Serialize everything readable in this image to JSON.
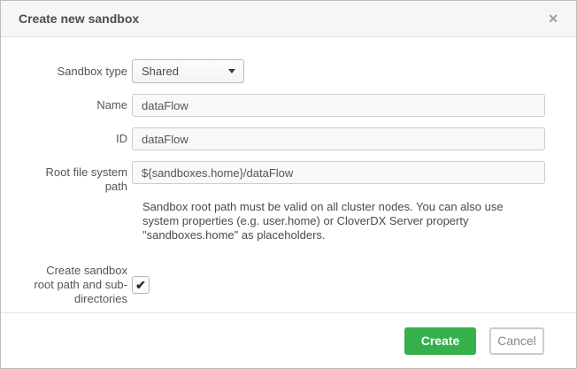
{
  "dialog": {
    "title": "Create new sandbox"
  },
  "icons": {
    "close": "✕",
    "checkmark": "✔"
  },
  "form": {
    "sandbox_type": {
      "label": "Sandbox type",
      "value": "Shared"
    },
    "name": {
      "label": "Name",
      "value": "dataFlow"
    },
    "id": {
      "label": "ID",
      "value": "dataFlow"
    },
    "root_path": {
      "label": "Root file system path",
      "value": "${sandboxes.home}/dataFlow",
      "help_lines": [
        "Sandbox root path must be valid on all cluster nodes. You can also use",
        "system properties (e.g. user.home) or CloverDX Server property",
        "\"sandboxes.home\" as placeholders."
      ]
    },
    "create_dirs": {
      "label": "Create sandbox root path and sub-directories",
      "checked": true
    }
  },
  "buttons": {
    "create": "Create",
    "cancel": "Cancel"
  },
  "colors": {
    "accent_green": "#34b14a",
    "header_bg": "#f6f6f6",
    "border": "#bdbdbd"
  }
}
